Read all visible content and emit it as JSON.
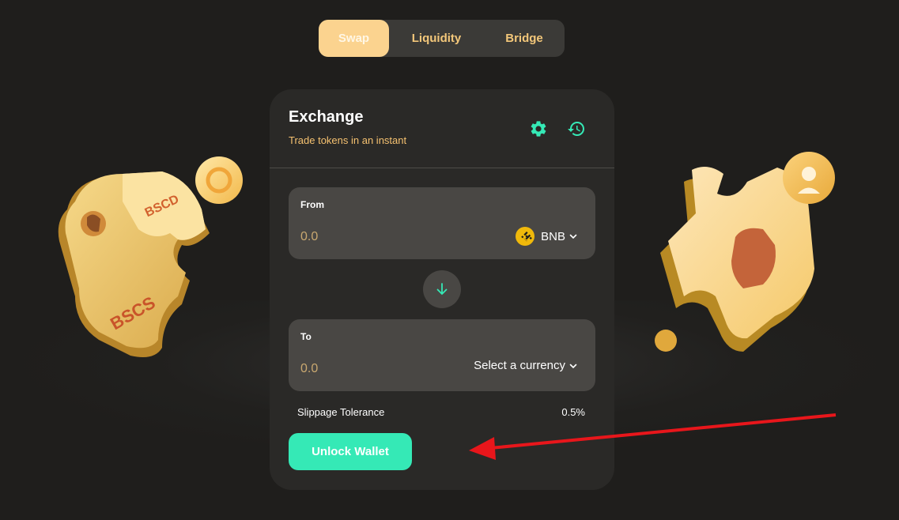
{
  "nav": {
    "tabs": [
      {
        "label": "Swap",
        "active": true
      },
      {
        "label": "Liquidity",
        "active": false
      },
      {
        "label": "Bridge",
        "active": false
      }
    ]
  },
  "exchange": {
    "title": "Exchange",
    "subtitle": "Trade tokens in an instant",
    "settings_icon": "gear-icon",
    "history_icon": "history-icon"
  },
  "from": {
    "label": "From",
    "amount_placeholder": "0.0",
    "token": "BNB"
  },
  "to": {
    "label": "To",
    "amount_placeholder": "0.0",
    "token": "Select a currency"
  },
  "slippage": {
    "label": "Slippage Tolerance",
    "value": "0.5%"
  },
  "actions": {
    "unlock_label": "Unlock Wallet"
  },
  "decor": {
    "left_puzzle_text_1": "BSCD",
    "left_puzzle_text_2": "BSCS"
  },
  "colors": {
    "accent": "#35e9b6",
    "gold": "#fbd38f",
    "subtitle": "#f5c170",
    "arrow": "#e8161b"
  }
}
